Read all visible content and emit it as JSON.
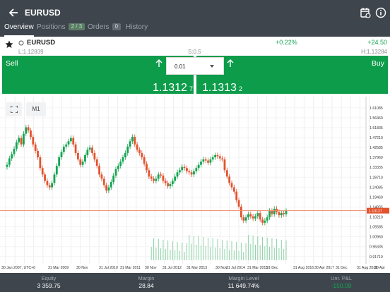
{
  "header": {
    "title": "EURUSD",
    "back_icon": "back-arrow-icon",
    "calendar_icon": "calendar-icon",
    "info_icon": "info-icon"
  },
  "tabs": [
    {
      "label": "Overview",
      "badge": ""
    },
    {
      "label": "Positions",
      "badge": "2 / 3"
    },
    {
      "label": "Orders",
      "badge": "0"
    },
    {
      "label": "History",
      "badge": ""
    }
  ],
  "symbol": {
    "name": "EURUSD",
    "change_pct": "+0.22%",
    "change_pts": "+24.50",
    "low": "L:1.12839",
    "spread": "S:0.5",
    "high": "H:1.13284"
  },
  "trade": {
    "sell_label": "Sell",
    "buy_label": "Buy",
    "quantity": "0.01",
    "sell_price": "1.1312",
    "sell_pip": "7",
    "buy_price": "1.1313",
    "buy_pip": "2"
  },
  "chart": {
    "timeframe": "M1",
    "current_price_label": "1.13127"
  },
  "footer": [
    {
      "label": "Equity",
      "value": "3 359.75"
    },
    {
      "label": "Margin",
      "value": "28.84"
    },
    {
      "label": "Margin Level",
      "value": "11 649.74%"
    },
    {
      "label": "Unr. P&L",
      "value": "-150.09"
    }
  ],
  "colors": {
    "header_bg": "#3e454d",
    "buy_sell_green": "#0d9c4a",
    "change_green": "#14a551",
    "bull_candle": "#14a551",
    "bear_candle": "#e2532e",
    "price_line": "#ef8b6c",
    "volume": "#8fd2a8",
    "pnl_negative": "#14a551"
  },
  "chart_data": {
    "type": "candlestick",
    "y_ticks": [
      "1.61085",
      "1.56460",
      "1.51835",
      "1.47210",
      "1.42585",
      "1.37960",
      "1.33335",
      "1.28710",
      "1.24085",
      "1.19460",
      "1.14835",
      "1.10210",
      "1.05585",
      "1.00960",
      "0.96335",
      "0.91710"
    ],
    "x_ticks": [
      "30 Jan 2007, UTC+0",
      "31 Mar 2009",
      "30 Nov",
      "31 Jul 2010",
      "31 Mar 2011",
      "30 Nov",
      "31 Jul 2012",
      "31 Mar 2013",
      "30 Nov",
      "31 Jul 2014",
      "31 Mar 2015",
      "31 Dec",
      "31 Aug 2016",
      "30 Apr 2017",
      "31 Dec",
      "31 Aug 2018",
      "30 Apr"
    ],
    "y_range": [
      0.9,
      1.63
    ],
    "last_price": 1.13127,
    "closes": [
      1.345,
      1.375,
      1.395,
      1.42,
      1.45,
      1.47,
      1.44,
      1.49,
      1.52,
      1.505,
      1.475,
      1.44,
      1.41,
      1.38,
      1.33,
      1.3,
      1.27,
      1.25,
      1.24,
      1.26,
      1.3,
      1.34,
      1.38,
      1.405,
      1.43,
      1.44,
      1.455,
      1.47,
      1.44,
      1.4,
      1.37,
      1.345,
      1.36,
      1.39,
      1.415,
      1.425,
      1.4,
      1.37,
      1.34,
      1.3,
      1.28,
      1.25,
      1.225,
      1.24,
      1.265,
      1.295,
      1.325,
      1.34,
      1.36,
      1.38,
      1.4,
      1.43,
      1.455,
      1.475,
      1.44,
      1.415,
      1.4,
      1.38,
      1.35,
      1.32,
      1.29,
      1.28,
      1.27,
      1.28,
      1.3,
      1.295,
      1.27,
      1.26,
      1.245,
      1.255,
      1.27,
      1.29,
      1.31,
      1.32,
      1.335,
      1.33,
      1.315,
      1.31,
      1.3,
      1.315,
      1.33,
      1.345,
      1.36,
      1.37,
      1.365,
      1.355,
      1.37,
      1.38,
      1.39,
      1.385,
      1.375,
      1.37,
      1.32,
      1.29,
      1.26,
      1.24,
      1.22,
      1.18,
      1.15,
      1.1,
      1.085,
      1.1,
      1.115,
      1.105,
      1.095,
      1.105,
      1.12,
      1.09,
      1.075,
      1.085,
      1.1,
      1.13,
      1.115,
      1.14,
      1.125,
      1.11,
      1.12,
      1.115,
      1.13
    ],
    "volumes": [
      0,
      0,
      0,
      0,
      0,
      0,
      0,
      0,
      0,
      0,
      0,
      0,
      0,
      0,
      0,
      0,
      0,
      0,
      0,
      0,
      0,
      0,
      0,
      0,
      0,
      0,
      0,
      0,
      0,
      0,
      0,
      0,
      0,
      0,
      0,
      0,
      0,
      0,
      0,
      0,
      0,
      0,
      0,
      0,
      0,
      0,
      0,
      0,
      0,
      0,
      0,
      0,
      0,
      0,
      0,
      0,
      0,
      0,
      0,
      0,
      0,
      0,
      0,
      0,
      0,
      0,
      0,
      0,
      0,
      0,
      0,
      0,
      0,
      0,
      0,
      0,
      0,
      0,
      0,
      0,
      0,
      0,
      0,
      0,
      0,
      0,
      0,
      0,
      0,
      0,
      0,
      0,
      0,
      0,
      0,
      0,
      0,
      0,
      0,
      0,
      0,
      0,
      0,
      0,
      0,
      0,
      0,
      0,
      0,
      0,
      0,
      0,
      0,
      0,
      0,
      0,
      0,
      0,
      0,
      0,
      0
    ]
  }
}
